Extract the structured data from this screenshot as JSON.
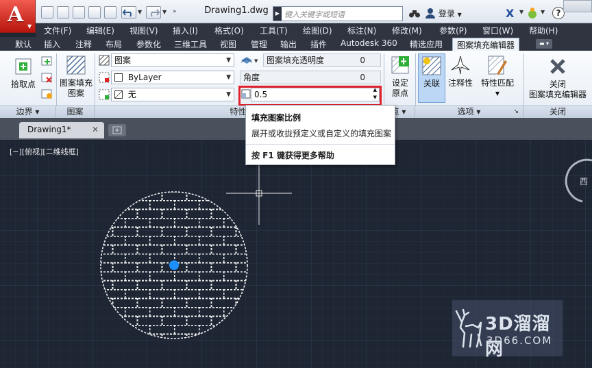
{
  "app": {
    "logo_letter": "A",
    "doc_title": "Drawing1.dwg",
    "search_placeholder": "键入关键字或短语",
    "login": "登录"
  },
  "menu": [
    "文件(F)",
    "编辑(E)",
    "视图(V)",
    "插入(I)",
    "格式(O)",
    "工具(T)",
    "绘图(D)",
    "标注(N)",
    "修改(M)",
    "参数(P)",
    "窗口(W)",
    "帮助(H)"
  ],
  "tabs": [
    "默认",
    "插入",
    "注释",
    "布局",
    "参数化",
    "三维工具",
    "视图",
    "管理",
    "输出",
    "插件",
    "Autodesk 360",
    "精选应用",
    "图案填充编辑器"
  ],
  "active_tab": "图案填充编辑器",
  "ribbon": {
    "pick_point": "拾取点",
    "boundary_panel": "边界",
    "pattern_btn_l1": "图案填充",
    "pattern_btn_l2": "图案",
    "pattern_panel": "图案",
    "hatch_type": "图案",
    "color": "ByLayer",
    "background": "无",
    "transparency_label": "图案填充透明度",
    "transparency_value": "0",
    "angle_label": "角度",
    "angle_value": "0",
    "scale_value": "0.5",
    "properties_panel": "特性",
    "origin_panel": "点",
    "set_origin_l1": "设定",
    "set_origin_l2": "原点",
    "associative": "关联",
    "annotative": "注释性",
    "match_props": "特性匹配",
    "options_panel": "选项",
    "close_l1": "关闭",
    "close_l2": "图案填充编辑器",
    "close_panel": "关闭"
  },
  "file_tab": "Drawing1*",
  "view_label": "[−][俯视][二维线框]",
  "compass_label": "西",
  "tooltip": {
    "title": "填充图案比例",
    "desc": "展开或收拢预定义或自定义的填充图案",
    "help": "按 F1 键获得更多帮助"
  },
  "watermark": {
    "brand": "3D溜溜网",
    "url": "3D66.COM"
  },
  "colors": {
    "canvas": "#1e2533",
    "highlight": "#e0202a",
    "centerpoint": "#1e8fff",
    "menubar": "#2f3440"
  }
}
